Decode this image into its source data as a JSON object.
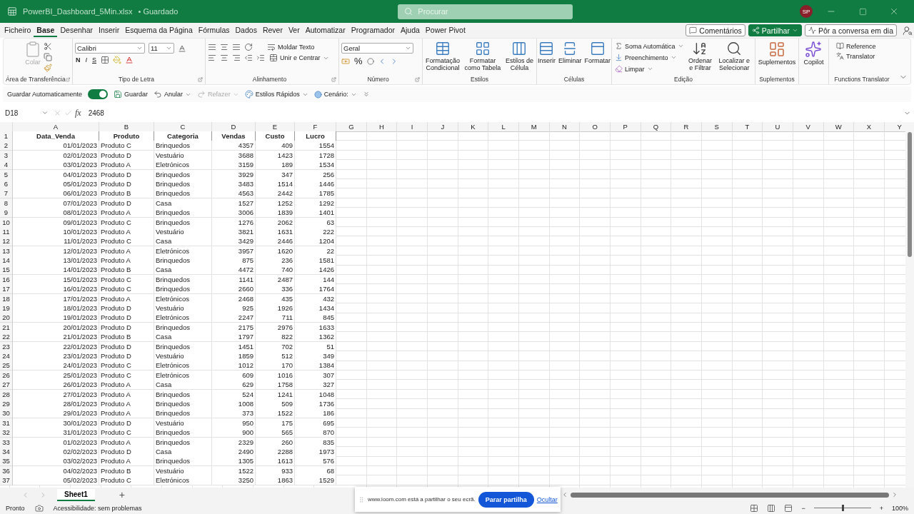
{
  "window": {
    "file": "PowerBI_Dashboard_5Min.xlsx",
    "status": "• Guardado",
    "search_placeholder": "Procurar",
    "avatar": "SP"
  },
  "menu_tabs": [
    {
      "label": "Ficheiro",
      "selected": false
    },
    {
      "label": "Base",
      "selected": true
    },
    {
      "label": "Desenhar",
      "selected": false
    },
    {
      "label": "Inserir",
      "selected": false
    },
    {
      "label": "Esquema da Página",
      "selected": false
    },
    {
      "label": "Fórmulas",
      "selected": false
    },
    {
      "label": "Dados",
      "selected": false
    },
    {
      "label": "Rever",
      "selected": false
    },
    {
      "label": "Ver",
      "selected": false
    },
    {
      "label": "Automatizar",
      "selected": false
    },
    {
      "label": "Programador",
      "selected": false
    },
    {
      "label": "Ajuda",
      "selected": false
    },
    {
      "label": "Power Pivot",
      "selected": false
    }
  ],
  "actions": {
    "comments": "Comentários",
    "share": "Partilhar",
    "catch_up": "Pôr a conversa em dia"
  },
  "ribbon": {
    "clipboard": {
      "title": "Área de Transferência",
      "paste": {
        "label": "Colar",
        "disabled": true
      }
    },
    "font": {
      "title": "Tipo de Letra",
      "font_name": "Calibri",
      "font_size": "11",
      "bold": "N",
      "italic": "I",
      "underline": "S"
    },
    "alignment": {
      "title": "Alinhamento",
      "wrap": "Moldar Texto",
      "merge": "Unir e Centrar"
    },
    "number": {
      "title": "Número",
      "format": "Geral",
      "percent": "%"
    },
    "styles": {
      "title": "Estilos",
      "buttons": [
        "Formatação Condicional",
        "Formatar como Tabela",
        "Estilos de Célula"
      ]
    },
    "cells": {
      "title": "Células",
      "buttons": [
        "Inserir",
        "Eliminar",
        "Formatar"
      ]
    },
    "editing": {
      "title": "Edição",
      "autosum": "Soma Automática",
      "fill": "Preenchimento",
      "clear": "Limpar",
      "sort": "Ordenar e Filtrar",
      "find": "Localizar e Selecionar"
    },
    "addins": {
      "title": "Suplementos",
      "button": "Suplementos"
    },
    "copilot": {
      "button": "Copilot"
    },
    "translator": {
      "title": "Functions Translator",
      "items": [
        "Reference",
        "Translator"
      ]
    }
  },
  "quick_access": {
    "autosave": {
      "label": "Guardar Automaticamente",
      "on": true
    },
    "save": "Guardar",
    "undo": "Anular",
    "redo": {
      "label": "Refazer",
      "disabled": true
    },
    "quick_styles": "Estilos Rápidos",
    "scenario": "Cenário:"
  },
  "formula_bar": {
    "name_box": "D18",
    "fx": "fx",
    "formula": "2468"
  },
  "sheet": {
    "columns": [
      "A",
      "B",
      "C",
      "D",
      "E",
      "F",
      "G",
      "H",
      "I",
      "J",
      "K",
      "L",
      "M",
      "N",
      "O",
      "P",
      "Q",
      "R",
      "S",
      "T",
      "U",
      "V",
      "W",
      "X",
      "Y"
    ],
    "header": {
      "number": "1",
      "cells": [
        "Data_Venda",
        "Produto",
        "Categoria",
        "Vendas",
        "Custo",
        "Lucro"
      ]
    },
    "rows": [
      {
        "number": "2",
        "cells": [
          "01/01/2023",
          "Produto C",
          "Brinquedos",
          "4357",
          "409",
          "1554"
        ]
      },
      {
        "number": "3",
        "cells": [
          "02/01/2023",
          "Produto D",
          "Vestuário",
          "3688",
          "1423",
          "1728"
        ]
      },
      {
        "number": "4",
        "cells": [
          "03/01/2023",
          "Produto A",
          "Eletrónicos",
          "3159",
          "189",
          "1534"
        ]
      },
      {
        "number": "5",
        "cells": [
          "04/01/2023",
          "Produto D",
          "Brinquedos",
          "3929",
          "347",
          "256"
        ]
      },
      {
        "number": "6",
        "cells": [
          "05/01/2023",
          "Produto D",
          "Brinquedos",
          "3483",
          "1514",
          "1446"
        ]
      },
      {
        "number": "7",
        "cells": [
          "06/01/2023",
          "Produto B",
          "Brinquedos",
          "4563",
          "2442",
          "1785"
        ]
      },
      {
        "number": "8",
        "cells": [
          "07/01/2023",
          "Produto D",
          "Casa",
          "1527",
          "1252",
          "1292"
        ]
      },
      {
        "number": "9",
        "cells": [
          "08/01/2023",
          "Produto A",
          "Brinquedos",
          "3006",
          "1839",
          "1401"
        ]
      },
      {
        "number": "10",
        "cells": [
          "09/01/2023",
          "Produto C",
          "Brinquedos",
          "1276",
          "2062",
          "63"
        ]
      },
      {
        "number": "11",
        "cells": [
          "10/01/2023",
          "Produto A",
          "Vestuário",
          "3821",
          "1631",
          "222"
        ]
      },
      {
        "number": "12",
        "cells": [
          "11/01/2023",
          "Produto C",
          "Casa",
          "3429",
          "2446",
          "1204"
        ]
      },
      {
        "number": "13",
        "cells": [
          "12/01/2023",
          "Produto A",
          "Eletrónicos",
          "3957",
          "1620",
          "22"
        ]
      },
      {
        "number": "14",
        "cells": [
          "13/01/2023",
          "Produto A",
          "Brinquedos",
          "875",
          "236",
          "1581"
        ]
      },
      {
        "number": "15",
        "cells": [
          "14/01/2023",
          "Produto B",
          "Casa",
          "4472",
          "740",
          "1426"
        ]
      },
      {
        "number": "16",
        "cells": [
          "15/01/2023",
          "Produto C",
          "Brinquedos",
          "1141",
          "2487",
          "144"
        ]
      },
      {
        "number": "17",
        "cells": [
          "16/01/2023",
          "Produto C",
          "Brinquedos",
          "2660",
          "336",
          "1764"
        ]
      },
      {
        "number": "18",
        "cells": [
          "17/01/2023",
          "Produto A",
          "Eletrónicos",
          "2468",
          "435",
          "432"
        ]
      },
      {
        "number": "19",
        "cells": [
          "18/01/2023",
          "Produto D",
          "Vestuário",
          "925",
          "1926",
          "1434"
        ]
      },
      {
        "number": "20",
        "cells": [
          "19/01/2023",
          "Produto D",
          "Eletrónicos",
          "2247",
          "711",
          "845"
        ]
      },
      {
        "number": "21",
        "cells": [
          "20/01/2023",
          "Produto D",
          "Brinquedos",
          "2175",
          "2976",
          "1633"
        ]
      },
      {
        "number": "22",
        "cells": [
          "21/01/2023",
          "Produto B",
          "Casa",
          "1797",
          "822",
          "1362"
        ]
      },
      {
        "number": "23",
        "cells": [
          "22/01/2023",
          "Produto D",
          "Brinquedos",
          "1451",
          "702",
          "51"
        ]
      },
      {
        "number": "24",
        "cells": [
          "23/01/2023",
          "Produto D",
          "Vestuário",
          "1859",
          "512",
          "349"
        ]
      },
      {
        "number": "25",
        "cells": [
          "24/01/2023",
          "Produto C",
          "Eletrónicos",
          "1012",
          "170",
          "1384"
        ]
      },
      {
        "number": "26",
        "cells": [
          "25/01/2023",
          "Produto C",
          "Eletrónicos",
          "609",
          "1016",
          "307"
        ]
      },
      {
        "number": "27",
        "cells": [
          "26/01/2023",
          "Produto A",
          "Casa",
          "629",
          "1758",
          "327"
        ]
      },
      {
        "number": "28",
        "cells": [
          "27/01/2023",
          "Produto A",
          "Brinquedos",
          "524",
          "1241",
          "1048"
        ]
      },
      {
        "number": "29",
        "cells": [
          "28/01/2023",
          "Produto A",
          "Brinquedos",
          "1008",
          "509",
          "1736"
        ]
      },
      {
        "number": "30",
        "cells": [
          "29/01/2023",
          "Produto A",
          "Brinquedos",
          "373",
          "1522",
          "186"
        ]
      },
      {
        "number": "31",
        "cells": [
          "30/01/2023",
          "Produto D",
          "Vestuário",
          "950",
          "175",
          "695"
        ]
      },
      {
        "number": "32",
        "cells": [
          "31/01/2023",
          "Produto C",
          "Brinquedos",
          "900",
          "565",
          "870"
        ]
      },
      {
        "number": "33",
        "cells": [
          "01/02/2023",
          "Produto A",
          "Brinquedos",
          "2329",
          "260",
          "835"
        ]
      },
      {
        "number": "34",
        "cells": [
          "02/02/2023",
          "Produto D",
          "Casa",
          "2490",
          "2288",
          "1973"
        ]
      },
      {
        "number": "35",
        "cells": [
          "03/02/2023",
          "Produto A",
          "Brinquedos",
          "1305",
          "1613",
          "576"
        ]
      },
      {
        "number": "36",
        "cells": [
          "04/02/2023",
          "Produto B",
          "Vestuário",
          "1522",
          "933",
          "68"
        ]
      },
      {
        "number": "37",
        "cells": [
          "05/02/2023",
          "Produto C",
          "Eletrónicos",
          "3250",
          "1863",
          "1529"
        ]
      }
    ]
  },
  "sheet_tabs": [
    {
      "label": "Sheet1",
      "selected": true
    }
  ],
  "add_sheet": "+",
  "share_bar": {
    "message": "www.loom.com está a partilhar o seu ecrã.",
    "stop": "Parar partilha",
    "hide": "Ocultar"
  },
  "status_bar": {
    "ready": "Pronto",
    "accessibility": "Acessibilidade: sem problemas",
    "zoom_minus": "−",
    "zoom_plus": "+",
    "zoom": "100%",
    "zoom_slider": {
      "level": 0.5
    }
  }
}
